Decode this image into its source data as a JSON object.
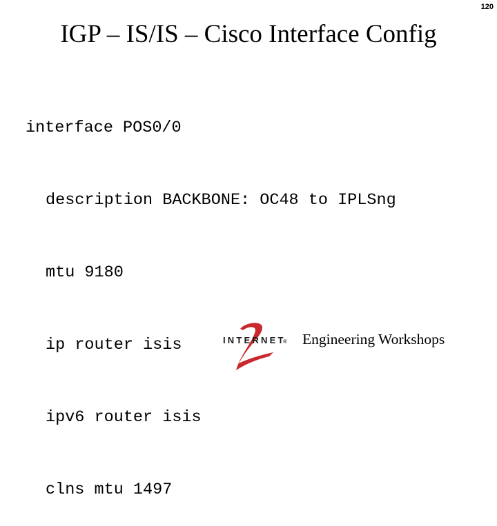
{
  "page_number": "120",
  "title": "IGP – IS/IS – Cisco Interface Config",
  "config": {
    "lines": [
      {
        "text": "interface POS0/0",
        "indent": false
      },
      {
        "text": "description BACKBONE: OC48 to IPLSng",
        "indent": true
      },
      {
        "text": "mtu 9180",
        "indent": true
      },
      {
        "text": "ip router isis",
        "indent": true
      },
      {
        "text": "ipv6 router isis",
        "indent": true
      },
      {
        "text": "clns mtu 1497",
        "indent": true
      }
    ]
  },
  "footer": {
    "logo_text": "INTERNET",
    "logo_mark": "®",
    "logo_color": "#c8282e",
    "text": "Engineering Workshops"
  }
}
